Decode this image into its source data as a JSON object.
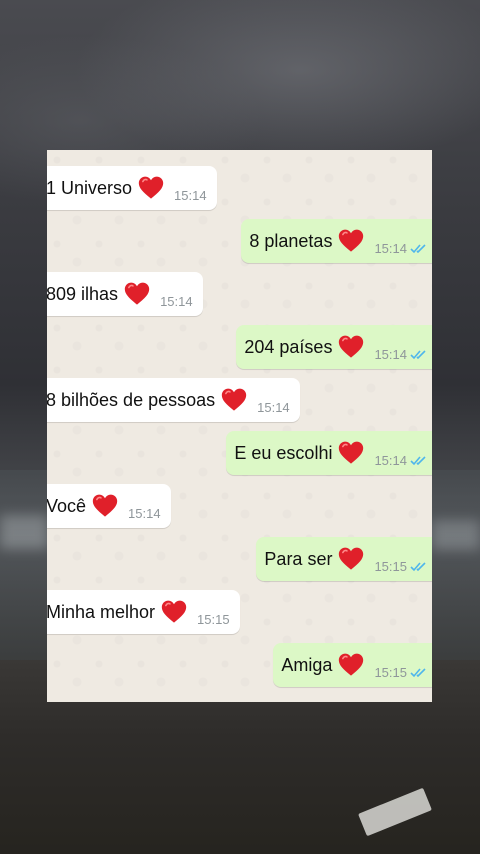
{
  "colors": {
    "incoming_bubble": "#ffffff",
    "outgoing_bubble": "#dcf8c6",
    "chat_background": "#efeae2",
    "read_ticks": "#4fb6ec",
    "heart": "#e0202a"
  },
  "icons": {
    "heart": "red-heart-emoji",
    "ticks": "double-check-read-icon"
  },
  "messages": [
    {
      "side": "in",
      "text": "1 Universo",
      "time": "15:14"
    },
    {
      "side": "out",
      "text": "8 planetas",
      "time": "15:14"
    },
    {
      "side": "in",
      "text": "809 ilhas",
      "time": "15:14"
    },
    {
      "side": "out",
      "text": "204 países",
      "time": "15:14"
    },
    {
      "side": "in",
      "text": "8 bilhões de pessoas",
      "time": "15:14"
    },
    {
      "side": "out",
      "text": "E eu escolhi",
      "time": "15:14"
    },
    {
      "side": "in",
      "text": "Você",
      "time": "15:14"
    },
    {
      "side": "out",
      "text": "Para ser",
      "time": "15:15"
    },
    {
      "side": "in",
      "text": "Minha melhor",
      "time": "15:15"
    },
    {
      "side": "out",
      "text": "Amiga",
      "time": "15:15"
    }
  ]
}
